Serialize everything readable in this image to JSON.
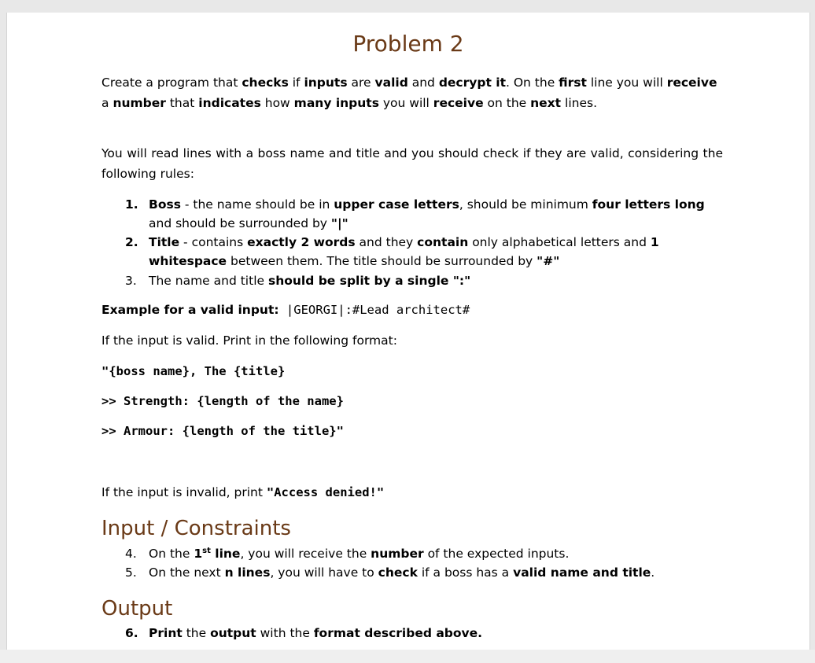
{
  "title": "Problem 2",
  "intro": {
    "t1": "Create a program that ",
    "b1": "checks",
    "t2": " if ",
    "b2": "inputs",
    "t3": " are ",
    "b3": "valid",
    "t4": " and ",
    "b4": "decrypt it",
    "t5": ". On the ",
    "b5": "first",
    "t6": " line you will ",
    "b6": "receive",
    "t7": " a ",
    "b7": "number",
    "t8": " that ",
    "b8": "indicates",
    "t9": " how ",
    "b9": "many inputs",
    "t10": " you will ",
    "b10": "receive",
    "t11": " on the ",
    "b11": "next",
    "t12": " lines."
  },
  "read_para": "You will read lines with a boss name and title and you should check if they are valid, considering the following rules:",
  "rules": [
    {
      "num": "1.",
      "label": "Boss",
      "t1": " - the name should be in ",
      "b1": "upper case letters",
      "t2": ", should be minimum ",
      "b2": "four letters long",
      "t3": " and should be surrounded by ",
      "b3": "\"|\""
    },
    {
      "num": "2.",
      "label": "Title",
      "t1": " - contains ",
      "b1": "exactly 2 words",
      "t2": " and they ",
      "b2": "contain",
      "t3": " only alphabetical letters and ",
      "b3": "1 whitespace",
      "t4": " between them. The title should be surrounded by ",
      "b4": "\"#\""
    },
    {
      "num": "3.",
      "t1": "The name and title ",
      "b1": "should be split by a single ",
      "b2": "\":\""
    }
  ],
  "example": {
    "label": "Example for a valid input:",
    "value": " |GEORGI|:#Lead architect#"
  },
  "valid_para": "If the input is valid. Print in the following format:",
  "format_lines": [
    "\"{boss name}, The {title}",
    ">> Strength: {length of the name}",
    ">> Armour: {length of the title}\""
  ],
  "invalid": {
    "t1": "If the input is invalid, print ",
    "code": "\"Access denied!\""
  },
  "input_heading": "Input / Constraints",
  "input_items": [
    {
      "num": "4.",
      "t1": "On the ",
      "b1": "1",
      "sup": "st",
      "b1b": " line",
      "t2": ", you will receive the ",
      "b2": "number",
      "t3": " of the expected inputs."
    },
    {
      "num": "5.",
      "t1": "On the next ",
      "b1": "n lines",
      "t2": ", you will have to ",
      "b2": "check",
      "t3": " if a boss has a ",
      "b3": "valid name and title",
      "t4": "."
    }
  ],
  "output_heading": "Output",
  "output_items": [
    {
      "num": "6.",
      "b1": "Print",
      "t1": " the ",
      "b2": "output",
      "t2": " with the ",
      "b3": "format described above."
    }
  ]
}
